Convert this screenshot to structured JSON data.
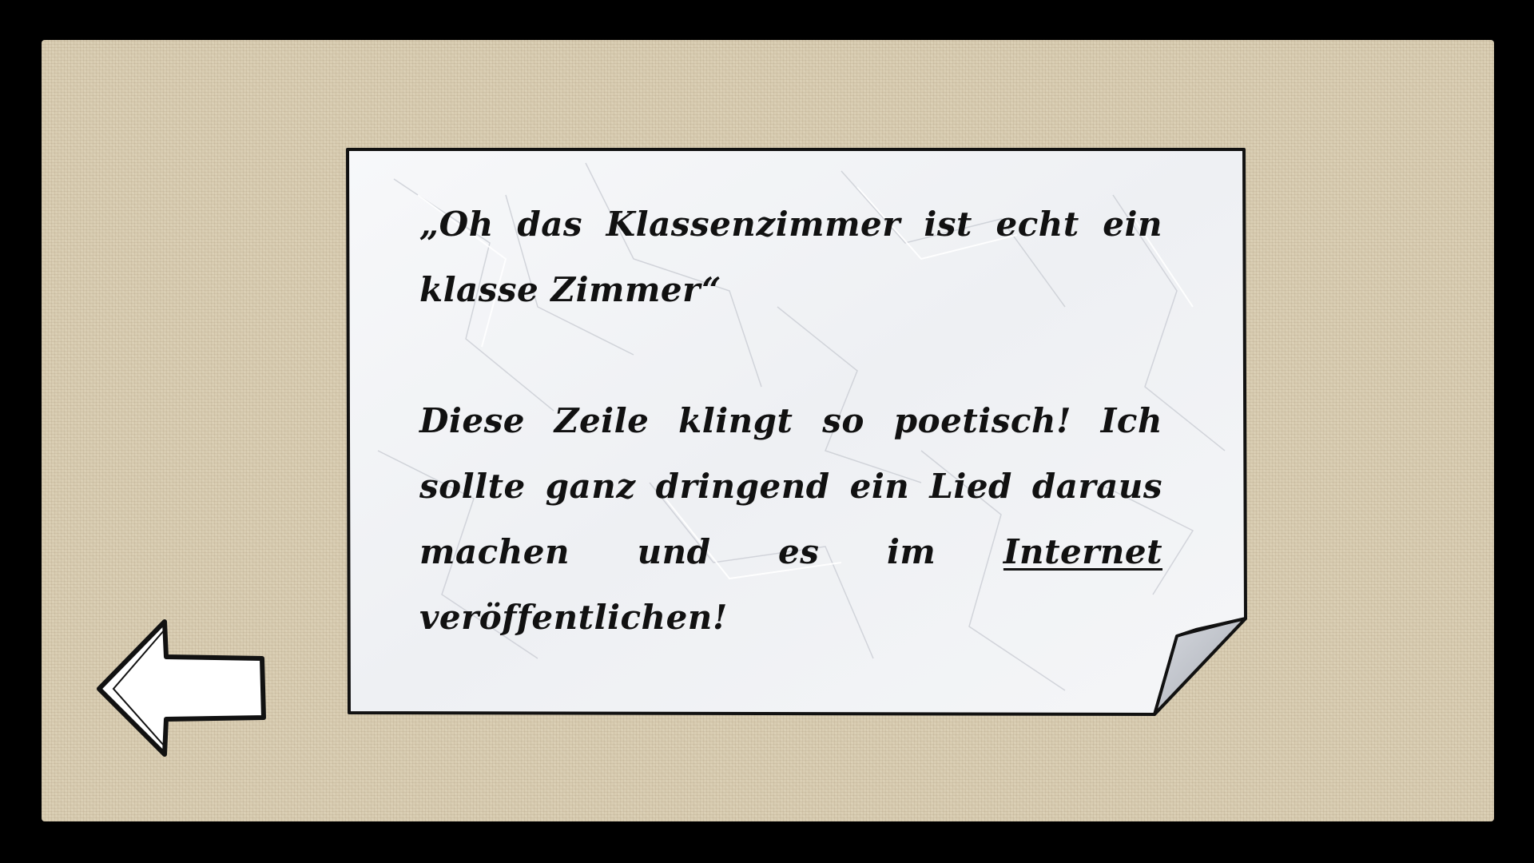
{
  "note": {
    "quote": "„Oh das Klassenzimmer ist echt ein klasse Zimmer“",
    "body_before_link": "Diese Zeile klingt so poetisch! Ich sollte ganz dringend ein Lied daraus machen und es im ",
    "link_text": "Internet",
    "body_after_link": " veröffentlichen!"
  },
  "navigation": {
    "back_icon": "left-arrow-icon"
  },
  "colors": {
    "background": "#000000",
    "frame": "#d9cdb2",
    "paper": "#f4f5f7",
    "ink": "#111111"
  }
}
